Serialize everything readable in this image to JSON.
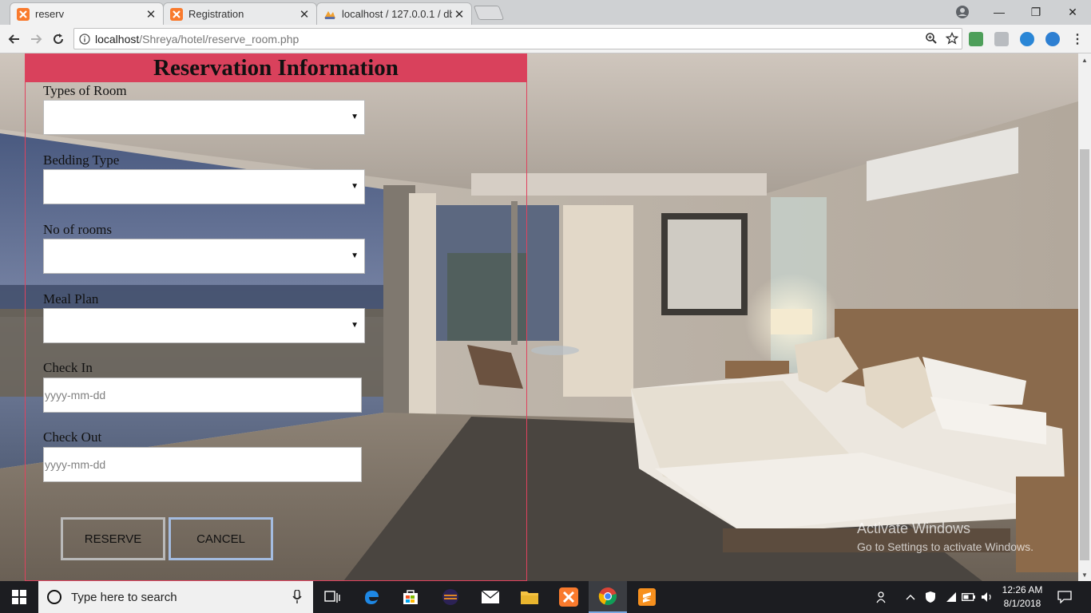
{
  "browser": {
    "tabs": [
      {
        "title": "reserv",
        "icon": "xampp-icon",
        "close": "✕"
      },
      {
        "title": "Registration",
        "icon": "xampp-icon",
        "close": "✕"
      },
      {
        "title": "localhost / 127.0.0.1 / db",
        "icon": "phpmyadmin-icon",
        "close": "✕"
      }
    ],
    "url_host": "localhost",
    "url_path": "/Shreya/hotel/reserve_room.php",
    "window_controls": {
      "minimize": "—",
      "maximize": "❐",
      "close": "✕"
    }
  },
  "form": {
    "title": "Reservation Information",
    "fields": {
      "room_type_label": "Types of Room",
      "bedding_label": "Bedding Type",
      "rooms_label": "No of rooms",
      "meal_label": "Meal Plan",
      "checkin_label": "Check In",
      "checkin_placeholder": "yyyy-mm-dd",
      "checkout_label": "Check Out",
      "checkout_placeholder": "yyyy-mm-dd"
    },
    "reserve_label": "RESERVE",
    "cancel_label": "CANCEL"
  },
  "watermark": {
    "line1": "Activate Windows",
    "line2": "Go to Settings to activate Windows."
  },
  "taskbar": {
    "search_placeholder": "Type here to search",
    "time": "12:26 AM",
    "date": "8/1/2018"
  },
  "colors": {
    "panel_header": "#d9415c",
    "panel_border": "#e0425e",
    "xampp_orange": "#f97a2d"
  }
}
